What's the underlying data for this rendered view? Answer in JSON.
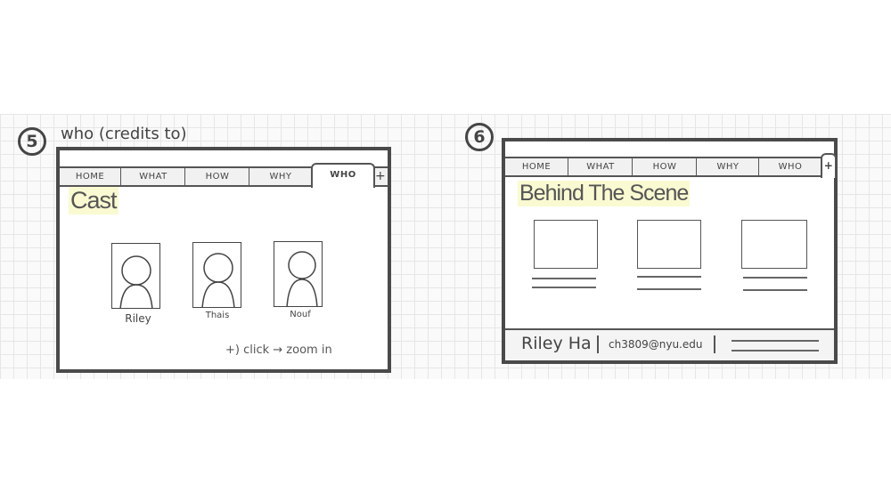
{
  "screens": [
    {
      "number": "5",
      "caption": "who (credits to)",
      "tabs": [
        "HOME",
        "WHAT",
        "HOW",
        "WHY",
        "WHO"
      ],
      "active_tab": "WHO",
      "add_tab_icon": "plus-icon",
      "heading": "Cast",
      "cast": [
        "Riley",
        "Thais",
        "Nouf"
      ],
      "note": "+) click → zoom in"
    },
    {
      "number": "6",
      "tabs": [
        "HOME",
        "WHAT",
        "HOW",
        "WHY",
        "WHO"
      ],
      "active_tab": "WHO",
      "add_tab_icon": "plus-icon",
      "heading": "Behind The Scene",
      "footer": {
        "name": "Riley Ha",
        "email": "ch3809@nyu.edu"
      }
    }
  ]
}
